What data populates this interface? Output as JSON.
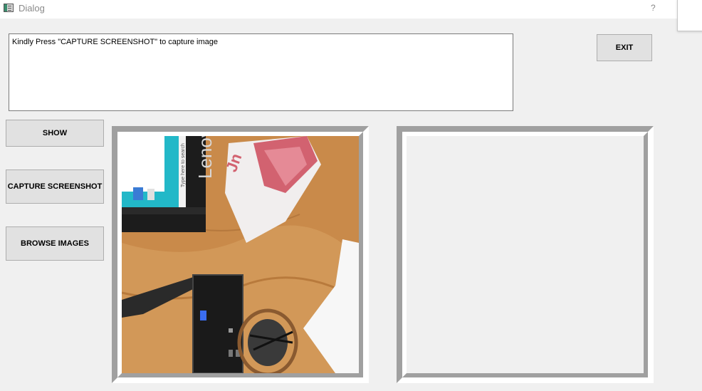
{
  "window": {
    "title": "Dialog",
    "help_label": "?"
  },
  "message": {
    "text": "Kindly Press \"CAPTURE SCREENSHOT\" to capture image"
  },
  "buttons": {
    "exit": "EXIT",
    "show": "SHOW",
    "capture": "CAPTURE SCREENSHOT",
    "browse": "BROWSE IMAGES"
  },
  "photo": {
    "brand_text": "Lenovo",
    "taskbar_search": "Type here to search"
  },
  "colors": {
    "background": "#f0f0f0",
    "button_face": "#e1e1e1",
    "frame_shadow": "#a0a0a0",
    "frame_highlight": "#ffffff"
  },
  "icons": {
    "app": "dialog-window-icon"
  }
}
